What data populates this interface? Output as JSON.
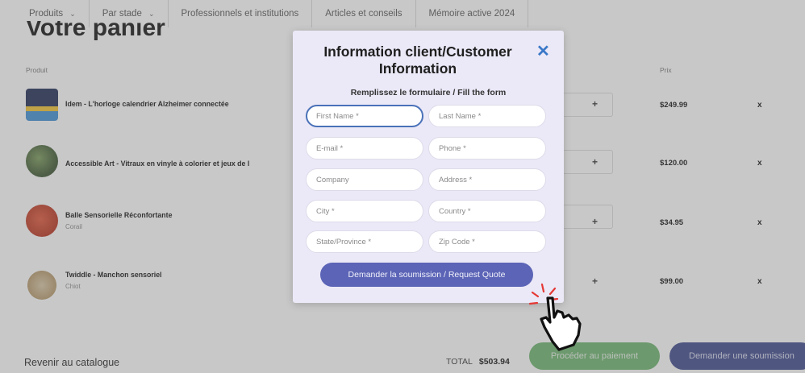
{
  "nav": {
    "items": [
      {
        "label": "Produits",
        "has_chevron": true
      },
      {
        "label": "Par stade",
        "has_chevron": true
      },
      {
        "label": "Professionnels et institutions",
        "has_chevron": false
      },
      {
        "label": "Articles et conseils",
        "has_chevron": false
      },
      {
        "label": "Mémoire active 2024",
        "has_chevron": false
      }
    ]
  },
  "cart": {
    "title": "Votre panier",
    "col_product": "Produit",
    "col_price": "Prix",
    "items": [
      {
        "name": "Idem - L'horloge calendrier Alzheimer connectée",
        "variant": "",
        "price": "$249.99"
      },
      {
        "name": "Accessible Art - Vitraux en vinyle à colorier et jeux de l",
        "variant": "",
        "price": "$120.00"
      },
      {
        "name": "Balle Sensorielle Réconfortante",
        "variant": "Corail",
        "price": "$34.95"
      },
      {
        "name": "Twiddle - Manchon sensoriel",
        "variant": "Chiot",
        "price": "$99.00"
      }
    ],
    "plus_symbol": "+",
    "remove_symbol": "x",
    "back_link": "Revenir au catalogue",
    "total_label": "TOTAL",
    "total_value": "$503.94",
    "pay_button": "Procéder au paiement",
    "quote_button": "Demander une soumission"
  },
  "modal": {
    "title": "Information client/Customer Information",
    "close_symbol": "✕",
    "subtitle": "Remplissez le formulaire / Fill the form",
    "fields": {
      "first_name": "First Name *",
      "last_name": "Last Name *",
      "email": "E-mail *",
      "phone": "Phone *",
      "company": "Company",
      "address": "Address *",
      "city": "City *",
      "country": "Country *",
      "state": "State/Province *",
      "zip": "Zip Code *"
    },
    "submit_label": "Demander la soumission / Request Quote"
  },
  "colors": {
    "modal_bg": "#ebe8f7",
    "submit_bg": "#5b64b6",
    "close_icon": "#3a78c8",
    "pay_button": "#6bb36c",
    "quote_button": "#3d478c",
    "click_burst": "#e53935"
  },
  "icons": {
    "close": "close-icon",
    "chevron": "chevron-down-icon",
    "cursor": "hand-pointer-icon",
    "click": "click-burst-icon"
  }
}
